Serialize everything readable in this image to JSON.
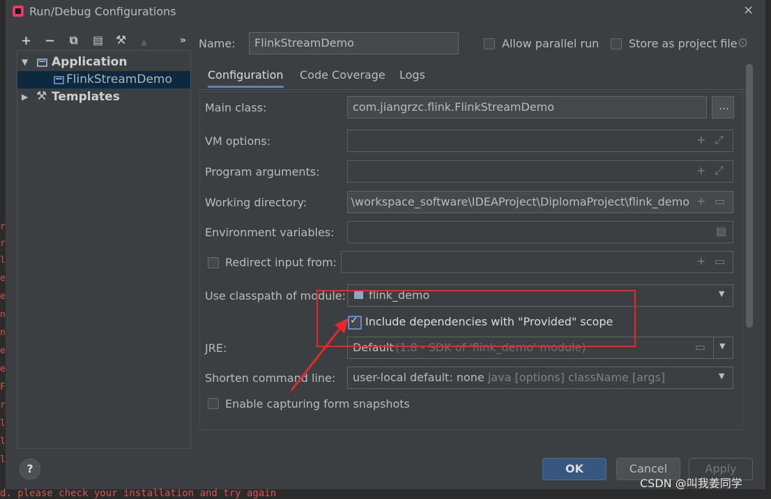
{
  "window": {
    "title": "Run/Debug Configurations",
    "close": "×"
  },
  "toolbar": {
    "add": "+",
    "remove": "−",
    "copy": "⧉",
    "save": "▤",
    "edit": "⚒",
    "up": "▲",
    "more": "»"
  },
  "tree": {
    "application": "Application",
    "child": "FlinkStreamDemo",
    "templates": "Templates"
  },
  "header": {
    "name_label": "Name:",
    "name_value": "FlinkStreamDemo",
    "allow_parallel": "Allow parallel run",
    "store_project": "Store as project file"
  },
  "tabs": [
    "Configuration",
    "Code Coverage",
    "Logs"
  ],
  "form": {
    "main_class_label": "Main class:",
    "main_class_value": "com.jiangrzc.flink.FlinkStreamDemo",
    "browse": "...",
    "vm_options_label": "VM options:",
    "program_args_label": "Program arguments:",
    "working_dir_label": "Working directory:",
    "working_dir_value": "D:\\workspace_software\\IDEAProject\\DiplomaProject\\flink_demo",
    "env_vars_label": "Environment variables:",
    "redirect_label": "Redirect input from:",
    "classpath_label": "Use classpath of module:",
    "classpath_value": "flink_demo",
    "include_deps": "Include dependencies with \"Provided\" scope",
    "jre_label": "JRE:",
    "jre_value": "Default",
    "jre_hint": "(1.8 - SDK of 'flink_demo' module)",
    "shorten_label": "Shorten command line:",
    "shorten_value": "user-local default: none",
    "shorten_hint": "- java [options] className [args]",
    "capture_label": "Enable capturing form snapshots"
  },
  "buttons": {
    "ok": "OK",
    "cancel": "Cancel",
    "apply": "Apply",
    "help": "?"
  },
  "background": {
    "bottom_text": "d. please check your installation and try again",
    "watermark": "CSDN @叫我姜同学"
  },
  "colors": {
    "accent": "#4a88c7",
    "annotation": "#e8282b"
  }
}
